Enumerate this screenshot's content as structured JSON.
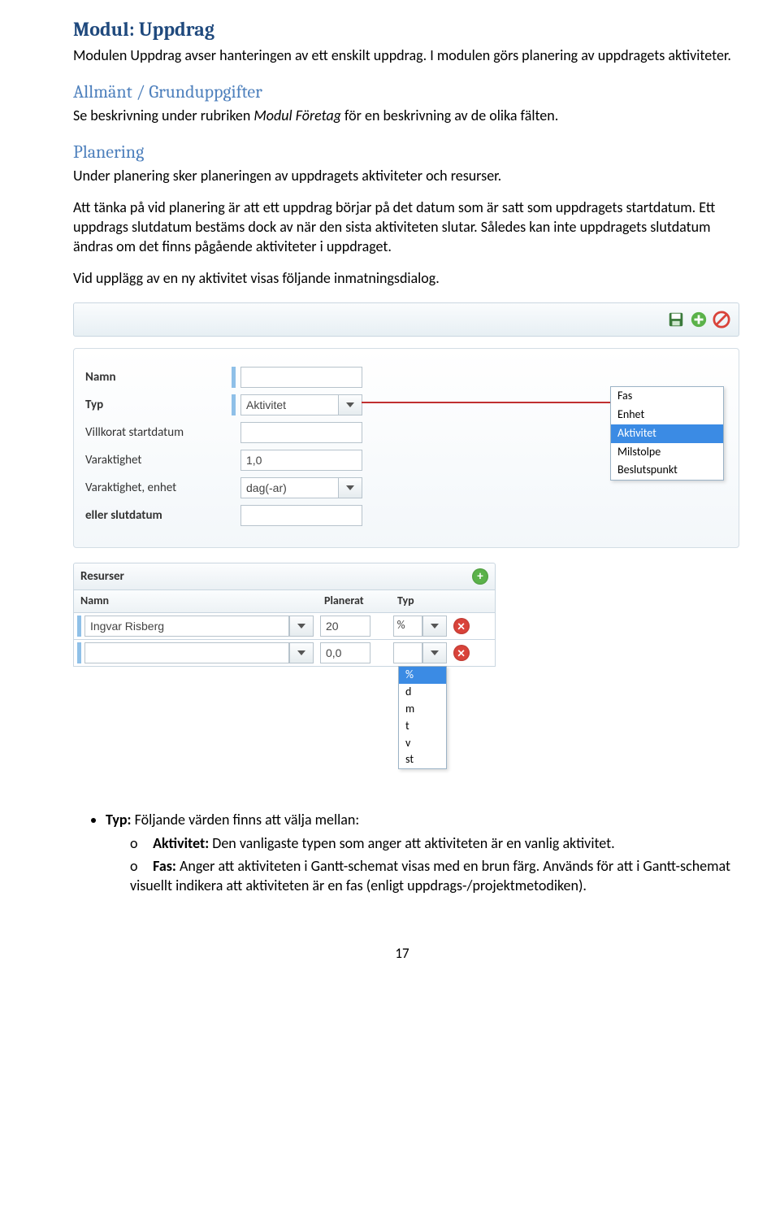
{
  "title": "Modul: Uppdrag",
  "intro": "Modulen Uppdrag avser hanteringen av ett enskilt uppdrag. I modulen görs planering av uppdragets aktiviteter.",
  "sections": {
    "allmant": {
      "heading": "Allmänt / Grunduppgifter",
      "text_pre": "Se beskrivning under rubriken ",
      "text_ital": "Modul Företag",
      "text_post": " för en beskrivning av de olika fälten."
    },
    "planering": {
      "heading": "Planering",
      "p1": "Under planering sker planeringen av uppdragets aktiviteter och resurser.",
      "p2": "Att tänka på vid planering är att ett uppdrag börjar på det datum som är satt som uppdragets startdatum. Ett uppdrags slutdatum bestäms dock av när den sista aktiviteten slutar. Således kan inte uppdragets slutdatum ändras om det finns pågående aktiviteter i uppdraget.",
      "p3": "Vid upplägg av en ny aktivitet visas följande inmatningsdialog."
    }
  },
  "form": {
    "labels": {
      "namn": "Namn",
      "typ": "Typ",
      "villkorat": "Villkorat startdatum",
      "varaktighet": "Varaktighet",
      "varaktighet_enhet": "Varaktighet, enhet",
      "slutdatum": "eller slutdatum"
    },
    "values": {
      "typ": "Aktivitet",
      "varaktighet": "1,0",
      "varaktighet_enhet": "dag(-ar)"
    },
    "typ_options": [
      "Fas",
      "Enhet",
      "Aktivitet",
      "Milstolpe",
      "Beslutspunkt"
    ],
    "typ_selected_index": 2
  },
  "resources": {
    "heading": "Resurser",
    "columns": {
      "name": "Namn",
      "planerat": "Planerat",
      "typ": "Typ"
    },
    "rows": [
      {
        "name": "Ingvar Risberg",
        "planerat": "20",
        "typ": "%"
      },
      {
        "name": "",
        "planerat": "0,0",
        "typ": ""
      }
    ],
    "typ_options": [
      "%",
      "d",
      "m",
      "t",
      "v",
      "st"
    ],
    "typ_selected_index": 0
  },
  "bullets": {
    "typ_label": "Typ:",
    "typ_text": " Följande värden finns att välja mellan:",
    "items": [
      {
        "label": "Aktivitet:",
        "text": " Den vanligaste typen som anger att aktiviteten är en vanlig aktivitet."
      },
      {
        "label": "Fas:",
        "text": " Anger att aktiviteten i Gantt-schemat visas med en brun färg. Används för att i Gantt-schemat visuellt indikera att aktiviteten är en fas (enligt uppdrags-/projektmetodiken)."
      }
    ]
  },
  "page_number": "17"
}
